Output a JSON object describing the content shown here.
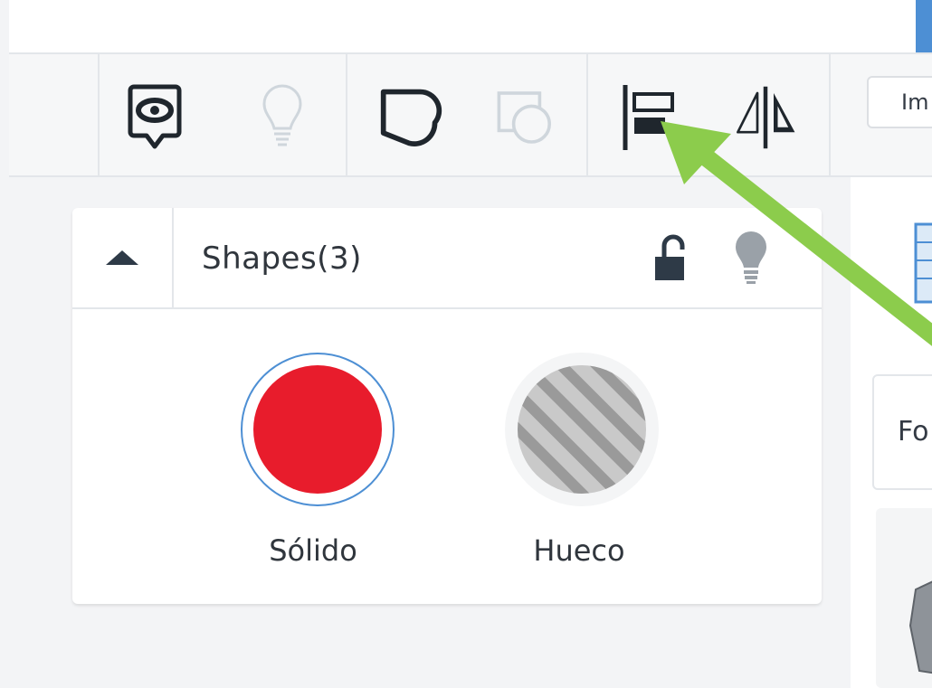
{
  "toolbar": {
    "import_label": "Im"
  },
  "panel": {
    "title": "Shapes(3)",
    "shapes": [
      {
        "label": "Sólido",
        "type": "solid",
        "color": "#e81c2c",
        "selected": true
      },
      {
        "label": "Hueco",
        "type": "hole",
        "selected": false
      }
    ]
  },
  "right_panel": {
    "card_label": "Fo"
  },
  "colors": {
    "accent_blue": "#4d8fd4",
    "solid_red": "#e81c2c",
    "annotation_arrow": "#8ccc4c",
    "icon_dark": "#1f262d",
    "icon_disabled": "#cfd6dc"
  }
}
